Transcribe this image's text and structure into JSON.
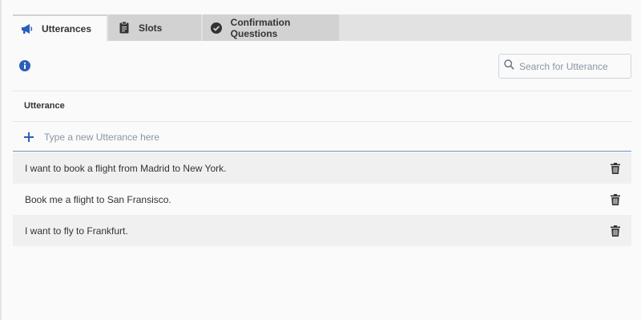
{
  "tabs": [
    {
      "label": "Utterances",
      "icon": "megaphone-icon",
      "active": true
    },
    {
      "label": "Slots",
      "icon": "clipboard-icon",
      "active": false
    },
    {
      "label": "Confirmation Questions",
      "icon": "check-circle-icon",
      "active": false
    }
  ],
  "search": {
    "placeholder": "Search for Utterance",
    "value": ""
  },
  "table": {
    "header": "Utterance",
    "new_placeholder": "Type a new Utterance here",
    "rows": [
      "I want to book a flight from Madrid to New York.",
      "Book me a flight to San Fransisco.",
      "I want to fly to Frankfurt."
    ]
  },
  "colors": {
    "accent": "#2b5fb8",
    "tab_active": "#fafafa",
    "tab_inactive": "#d2d2d2",
    "input_underline": "#6d94c9"
  }
}
